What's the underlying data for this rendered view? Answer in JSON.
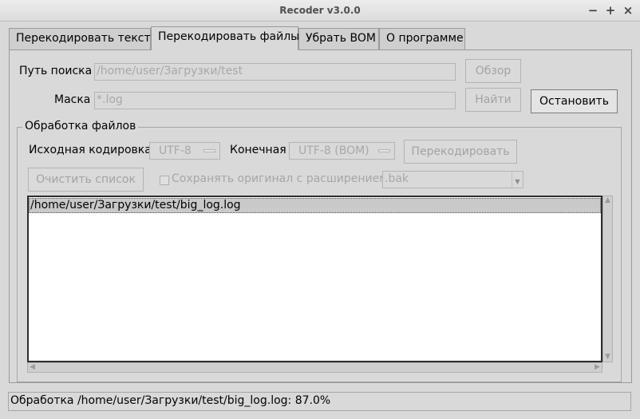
{
  "window": {
    "title": "Recoder v3.0.0",
    "controls": {
      "minimize": "−",
      "maximize": "+",
      "close": "×"
    }
  },
  "tabs": [
    {
      "label": "Перекодировать текст",
      "active": false
    },
    {
      "label": "Перекодировать файлы",
      "active": true
    },
    {
      "label": "Убрать BOM",
      "active": false
    },
    {
      "label": "О программе",
      "active": false
    }
  ],
  "search": {
    "path_label": "Путь поиска",
    "path_value": "/home/user/Загрузки/test",
    "browse_button": "Обзор",
    "mask_label": "Маска",
    "mask_value": "*.log",
    "find_button": "Найти",
    "stop_button": "Остановить"
  },
  "processing": {
    "group_title": "Обработка файлов",
    "source_label": "Исходная кодировка",
    "source_value": "UTF-8",
    "target_label": "Конечная",
    "target_value": "UTF-8 (BOM)",
    "recode_button": "Перекодировать",
    "clear_button": "Очистить список",
    "keep_original_label": "Сохранять оригинал с расширением",
    "keep_original_checked": false,
    "extension_value": ".bak"
  },
  "file_list": {
    "items": [
      "/home/user/Загрузки/test/big_log.log"
    ],
    "selected_index": 0
  },
  "status": {
    "text": "Обработка /home/user/Загрузки/test/big_log.log: 87.0%"
  }
}
